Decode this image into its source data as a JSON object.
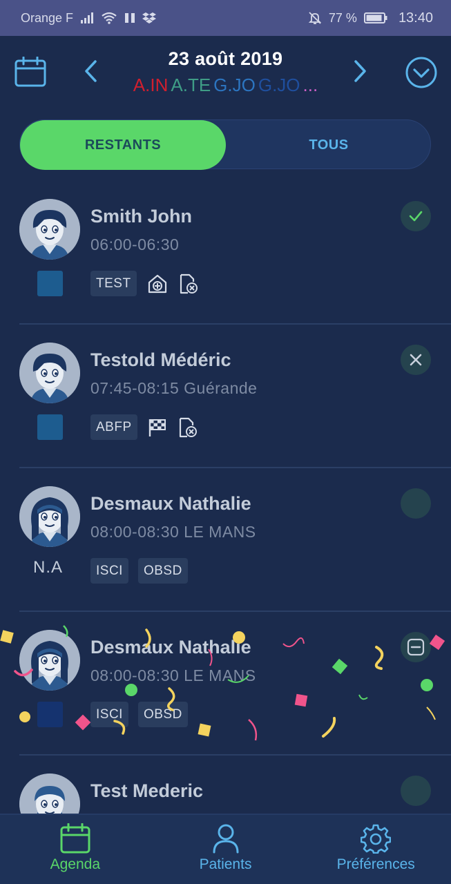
{
  "status_bar": {
    "carrier": "Orange F",
    "battery": "77 %",
    "time": "13:40"
  },
  "header": {
    "date": "23 août 2019",
    "teams": [
      {
        "label": "A.IN",
        "color": "#d01f2e"
      },
      {
        "label": "A.TE",
        "color": "#3f9d86"
      },
      {
        "label": "G.JO",
        "color": "#2c75c0"
      },
      {
        "label": "G.JO",
        "color": "#1f4f9e"
      },
      {
        "label": "...",
        "color": "#d060c8"
      }
    ]
  },
  "segment": {
    "restants": "RESTANTS",
    "tous": "TOUS",
    "selected": "restants"
  },
  "patients": [
    {
      "name": "Smith John",
      "time": "06:00-06:30",
      "color": "#1d5c8f",
      "tags": [
        "TEST"
      ],
      "icons": [
        "medical-bag-icon",
        "document-cancel-icon"
      ],
      "state": "check-icon",
      "avatar": "boy"
    },
    {
      "name": "Testold Médéric",
      "time": "07:45-08:15 Guérande",
      "color": "#1d5c8f",
      "tags": [
        "ABFP"
      ],
      "icons": [
        "checkered-flag-icon",
        "document-cancel-icon"
      ],
      "state": "close-icon",
      "avatar": "boy"
    },
    {
      "name": "Desmaux Nathalie",
      "time": "08:00-08:30 LE MANS",
      "na": "N.A",
      "tags": [
        "ISCI",
        "OBSD"
      ],
      "icons": [],
      "state": "empty",
      "avatar": "girl"
    },
    {
      "name": "Desmaux Nathalie",
      "time": "08:00-08:30 LE MANS",
      "color": "#15336f",
      "tags": [
        "ISCI",
        "OBSD"
      ],
      "icons": [],
      "state": "minus-icon",
      "avatar": "girl"
    },
    {
      "name": "Test Mederic",
      "time": "",
      "tags": [],
      "icons": [],
      "state": "empty",
      "avatar": "bearded"
    }
  ],
  "nav": {
    "agenda": "Agenda",
    "patients": "Patients",
    "preferences": "Préférences",
    "active": "agenda",
    "active_color": "#5ad769",
    "inactive_color": "#5ab4ea"
  }
}
